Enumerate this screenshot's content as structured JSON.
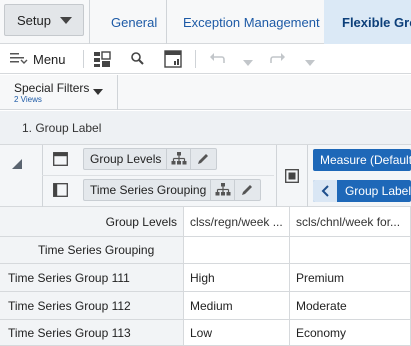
{
  "topbar": {
    "setup_label": "Setup",
    "tabs": [
      {
        "label": "General"
      },
      {
        "label": "Exception Management"
      },
      {
        "label": "Flexible Gro"
      }
    ]
  },
  "toolbar": {
    "menu_label": "Menu"
  },
  "filters": {
    "label": "Special Filters",
    "sublabel": "2 Views"
  },
  "group_row": {
    "label": "1. Group Label"
  },
  "pivot": {
    "row_chips": [
      {
        "label": "Group Levels"
      },
      {
        "label": "Time Series Grouping"
      }
    ],
    "measure_label": "Measure (Default",
    "group_label_btn": "Group Label"
  },
  "grid": {
    "header_labels": {
      "group_levels": "Group Levels",
      "time_series_grouping": "Time Series Grouping"
    },
    "columns": [
      "clss/regn/week ...",
      "scls/chnl/week for..."
    ],
    "rows": [
      {
        "label": "Time Series Group 111",
        "cells": [
          "High",
          "Premium"
        ]
      },
      {
        "label": "Time Series Group 112",
        "cells": [
          "Medium",
          "Moderate"
        ]
      },
      {
        "label": "Time Series Group 113",
        "cells": [
          "Low",
          "Economy"
        ]
      }
    ]
  },
  "colors": {
    "accent": "#1e68b8",
    "tab_text": "#1d5aa6",
    "active_tab_bg": "#dbe9f6"
  }
}
